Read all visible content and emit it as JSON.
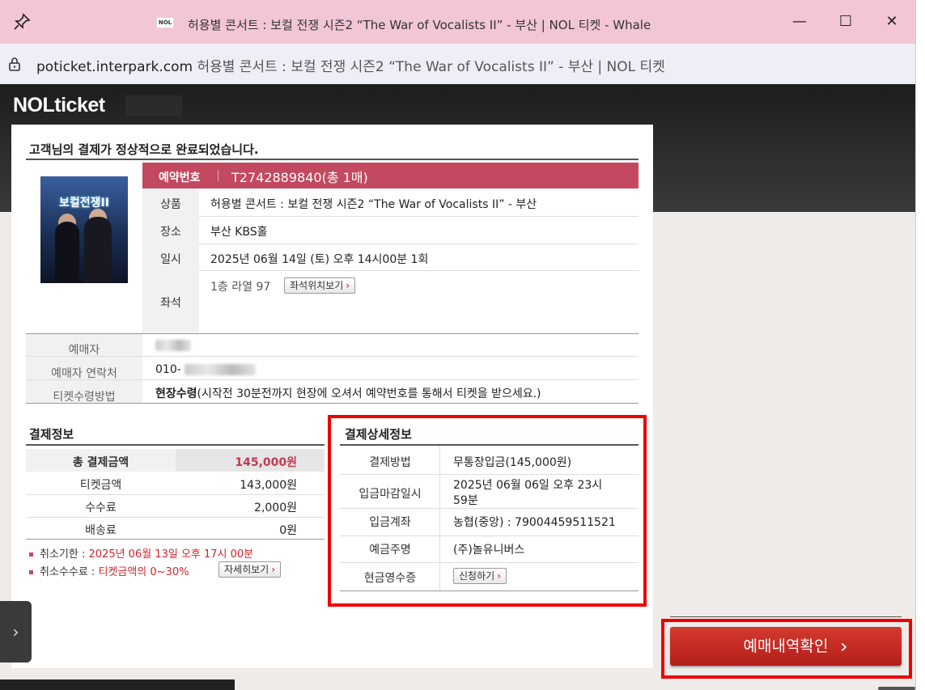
{
  "window": {
    "title": "허용별 콘서트 : 보컬 전쟁 시즌2 “The War of Vocalists II” - 부산 | NOL 티켓 - Whale",
    "favicon_text": "NOL",
    "minimize": "—",
    "maximize": "☐",
    "close": "✕"
  },
  "address": {
    "host": "poticket.interpark.com",
    "page_title": " 허용별 콘서트 : 보컬 전쟁 시즌2 “The War of Vocalists II” - 부산 | NOL 티켓"
  },
  "brand": {
    "logo": "NOLticket"
  },
  "complete_message": "고객님의 결제가 정상적으로 완료되었습니다.",
  "poster": {
    "title": "보컬전쟁II"
  },
  "reservation": {
    "label": "예약번호",
    "number": "T2742889840(총 1매)",
    "rows": {
      "product_label": "상품",
      "product_value": "허용별 콘서트 : 보컬 전쟁 시즌2 “The War of Vocalists II” - 부산",
      "venue_label": "장소",
      "venue_value": "부산 KBS홀",
      "date_label": "일시",
      "date_value": "2025년 06월 14일 (토) 오후 14시00분 1회",
      "seat_label": "좌석",
      "seat_value": "1층 라열 97",
      "seat_button": "좌석위치보기"
    }
  },
  "buyer": {
    "name_label": "예매자",
    "contact_label": "예매자 연락처",
    "contact_prefix": "010-",
    "method_label": "티켓수령방법",
    "method_bold": "현장수령",
    "method_desc": "(시작전 30분전까지 현장에 오셔서 예약번호를 통해서 티켓을 받으세요.)"
  },
  "payment_info": {
    "title": "결제정보",
    "total_label": "총 결제금액",
    "total_value": "145,000원",
    "ticket_label": "티켓금액",
    "ticket_value": "143,000원",
    "fee_label": "수수료",
    "fee_value": "2,000원",
    "delivery_label": "배송료",
    "delivery_value": "0원",
    "cancel_deadline_label": "취소기한 : ",
    "cancel_deadline_value": "2025년 06월 13일 오후 17시 00분",
    "cancel_fee_label": "취소수수료 : ",
    "cancel_fee_value": "티켓금액의 0~30%",
    "detail_button": "자세히보기"
  },
  "payment_detail": {
    "title": "결제상세정보",
    "method_label": "결제방법",
    "method_value": "무통장입금(145,000원)",
    "deadline_label": "입금마감일시",
    "deadline_value_1": "2025년 06월 06일 오후 23시",
    "deadline_value_2": "59분",
    "account_label": "입금계좌",
    "account_value": "농협(중앙) : 79004459511521",
    "holder_label": "예금주명",
    "holder_value": "(주)놀유니버스",
    "receipt_label": "현금영수증",
    "receipt_button": "신청하기"
  },
  "confirm_button": "예매내역확인",
  "side_tab": "›",
  "colors": {
    "accent": "#c2495f",
    "highlight": "#ee0000",
    "button": "#c3291f"
  }
}
